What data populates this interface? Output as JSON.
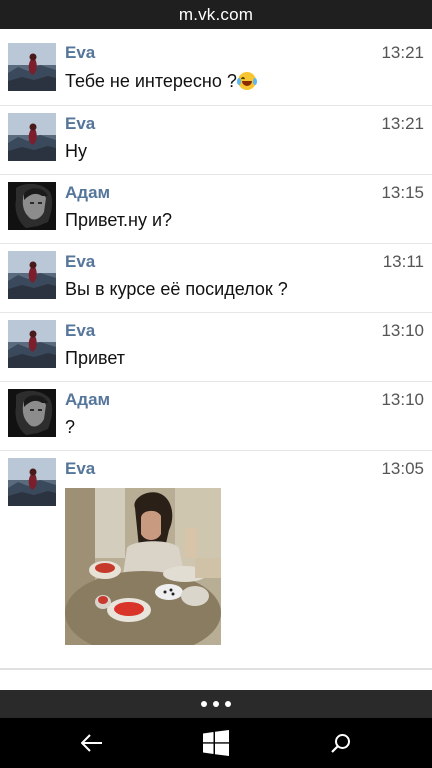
{
  "browser": {
    "url": "m.vk.com"
  },
  "messages": [
    {
      "author": "Eva",
      "time": "13:21",
      "text": "Тебе не интересно ?",
      "avatar": "eva"
    },
    {
      "author": "Eva",
      "time": "13:21",
      "text": "Ну",
      "avatar": "eva"
    },
    {
      "author": "Адам",
      "time": "13:15",
      "text": "Привет.ну и?",
      "avatar": "adam"
    },
    {
      "author": "Eva",
      "time": "13:11",
      "text": "Вы в курсе её посиделок ?",
      "avatar": "eva"
    },
    {
      "author": "Eva",
      "time": "13:10",
      "text": "Привет",
      "avatar": "eva"
    },
    {
      "author": "Адам",
      "time": "13:10",
      "text": "?",
      "avatar": "adam"
    },
    {
      "author": "Eva",
      "time": "13:05",
      "text": "",
      "avatar": "eva",
      "attachment": "photo"
    }
  ],
  "icons": {
    "emoji": "face-with-tears-of-joy-emoji",
    "more": "more-dots-icon",
    "back": "back-arrow-icon",
    "home": "windows-logo-icon",
    "search": "search-icon"
  },
  "colors": {
    "author": "#55759b",
    "topbar": "#1f1f1f",
    "navbar": "#000000"
  }
}
